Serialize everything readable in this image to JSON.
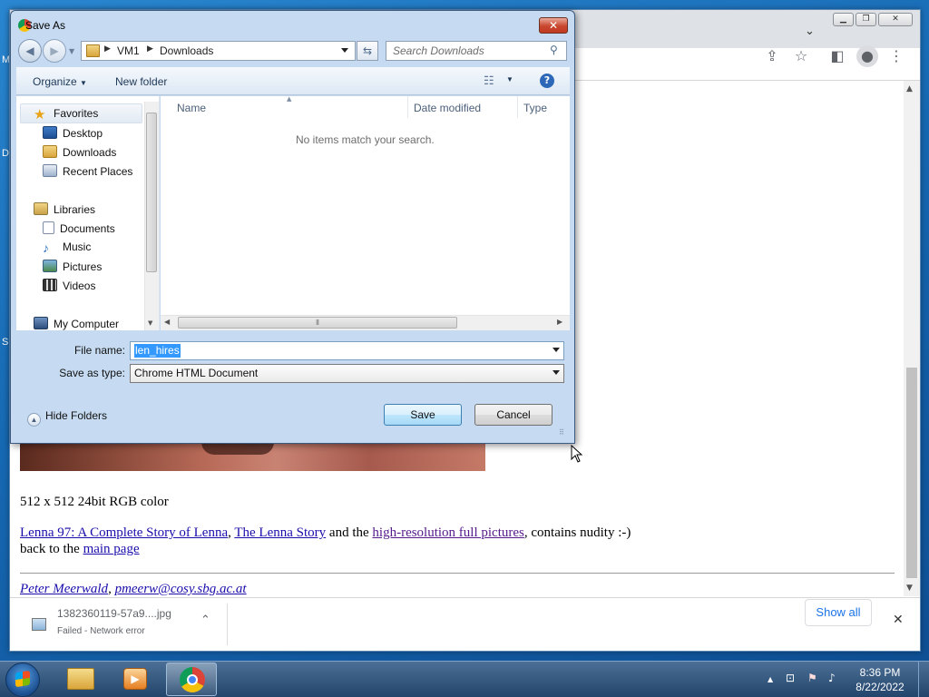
{
  "dialog": {
    "title": "Save As",
    "close_glyph": "✕",
    "breadcrumb": [
      "VM1",
      "Downloads"
    ],
    "search_placeholder": "Search Downloads",
    "toolbar": {
      "organize": "Organize",
      "new_folder": "New folder",
      "help_glyph": "?"
    },
    "nav": {
      "favorites": "Favorites",
      "favorites_items": [
        "Desktop",
        "Downloads",
        "Recent Places"
      ],
      "libraries": "Libraries",
      "libraries_items": [
        "Documents",
        "Music",
        "Pictures",
        "Videos"
      ],
      "computer": "My Computer"
    },
    "columns": [
      "Name",
      "Date modified",
      "Type"
    ],
    "empty_message": "No items match your search.",
    "file_name_label": "File name:",
    "file_name_value": "len_hires",
    "save_type_label": "Save as type:",
    "save_type_value": "Chrome HTML Document",
    "hide_folders": "Hide Folders",
    "save_button": "Save",
    "cancel_button": "Cancel"
  },
  "page": {
    "caption": "512 x 512 24bit RGB color",
    "links_line": {
      "link1": "Lenna 97: A Complete Story of Lenna",
      "sep1": ", ",
      "link2": "The Lenna Story",
      "mid": " and the ",
      "link3": "high-resolution full pictures",
      "tail": ", contains nudity :-)"
    },
    "back_prefix": "back to the ",
    "back_link": "main page",
    "author": "Peter Meerwald",
    "author_sep": ", ",
    "email": "pmeerw@cosy.sbg.ac.at"
  },
  "download": {
    "filename": "1382360119-57a9....jpg",
    "status": "Failed - Network error",
    "show_all": "Show all",
    "close_glyph": "✕"
  },
  "taskbar": {
    "time": "8:36 PM",
    "date": "8/22/2022"
  },
  "desktop_letters": [
    "M",
    "D",
    "S"
  ],
  "colors": {
    "link": "#1a0dab",
    "visited": "#551a8b",
    "selection": "#3399ff",
    "close_red": "#c8462e"
  }
}
